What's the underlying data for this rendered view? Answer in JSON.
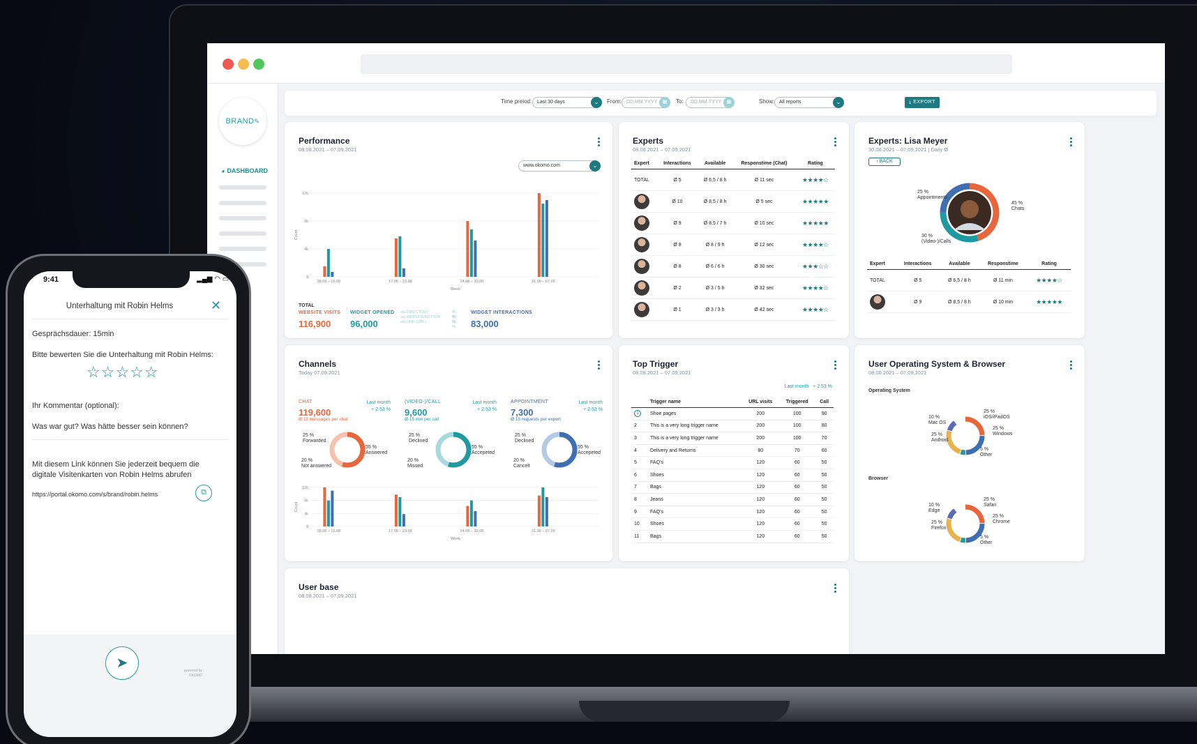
{
  "toolbar": {
    "time_label": "Time preiod:",
    "time_value": "Last 30 days",
    "from_label": "From:",
    "to_label": "To:",
    "date_placeholder": "DD.MM.YYYY",
    "show_label": "Show:",
    "show_value": "All reports",
    "export_label": "EXPORT"
  },
  "sidebar": {
    "brand": "BRAND",
    "nav_active": "DASHBOARD"
  },
  "performance": {
    "title": "Performance",
    "subtitle": "08.08.2021 – 07.09.2021",
    "filter": "www.okomo.com",
    "total_label": "TOTAL",
    "stats": [
      {
        "label": "WEBSITE VISITS",
        "value": "116,900"
      },
      {
        "label": "WIDGET OPENED",
        "value": "96,000"
      },
      {
        "label": "WIDGET INTERACTIONS",
        "value": "83,000"
      }
    ],
    "via": [
      {
        "label": "via DIRECTORY",
        "pct": "45 %"
      },
      {
        "label": "via WEBSITE/BUTTON",
        "pct": "40 %"
      },
      {
        "label": "via LINK (URL)",
        "pct": "15 %"
      }
    ]
  },
  "experts": {
    "title": "Experts",
    "subtitle": "08.08.2021 – 07.09.2021",
    "columns": [
      "Expert",
      "Interactions",
      "Available",
      "Responstime (Chat)",
      "Rating"
    ],
    "rows": [
      {
        "expert": "TOTAL",
        "inter": "Ø 5",
        "avail": "Ø 6,5 / 8 h",
        "resp": "Ø 11 sec",
        "rating": 4
      },
      {
        "expert": "",
        "inter": "Ø 10",
        "avail": "Ø 8,5 / 8 h",
        "resp": "Ø 5 sec",
        "rating": 5
      },
      {
        "expert": "",
        "inter": "Ø 9",
        "avail": "Ø 8,5 / 7 h",
        "resp": "Ø 10 sec",
        "rating": 5
      },
      {
        "expert": "",
        "inter": "Ø 8",
        "avail": "Ø 8 / 9 h",
        "resp": "Ø 12 sec",
        "rating": 4
      },
      {
        "expert": "",
        "inter": "Ø 8",
        "avail": "Ø 6 / 6 h",
        "resp": "Ø 30 sec",
        "rating": 3
      },
      {
        "expert": "",
        "inter": "Ø 2",
        "avail": "Ø 3 / 5 h",
        "resp": "Ø 32 sec",
        "rating": 4
      },
      {
        "expert": "",
        "inter": "Ø 1",
        "avail": "Ø 3 / 3 h",
        "resp": "Ø 42 sec",
        "rating": 4
      }
    ]
  },
  "lisa": {
    "title": "Experts: Lisa Meyer",
    "subtitle": "30.08.2021 – 07.09.2021 | Daily Ø",
    "back": "BACK",
    "donut_labels": [
      {
        "pct": "25 %",
        "name": "Appointments"
      },
      {
        "pct": "45 %",
        "name": "Chats"
      },
      {
        "pct": "30 %",
        "name": "(Video-)/Calls"
      }
    ],
    "columns": [
      "Expert",
      "Interactions",
      "Available",
      "Responstime",
      "Rating"
    ],
    "rows": [
      {
        "expert": "TOTAL",
        "inter": "Ø 5",
        "avail": "Ø 6,5 / 8 h",
        "resp": "Ø 11 min",
        "rating": 4
      },
      {
        "expert": "",
        "inter": "Ø 9",
        "avail": "Ø 8,5 / 8 h",
        "resp": "Ø 10 min",
        "rating": 5
      }
    ]
  },
  "channels": {
    "title": "Channels",
    "subtitle": "Today 07.09.2021",
    "blocks": [
      {
        "label": "CHAT",
        "value": "119,600",
        "sub": "Ø 15 messages per chat",
        "lm": "Last month",
        "delta": "+ 2.53 %",
        "a": "25 %",
        "an": "Forwarded",
        "b": "55 %",
        "bn": "Answered",
        "c": "20 %",
        "cn": "Not answered"
      },
      {
        "label": "(VIDEO-)/CALL",
        "value": "9,600",
        "sub": "Ø 15 min per call",
        "lm": "Last month",
        "delta": "+ 2.53 %",
        "a": "25 %",
        "an": "Declined",
        "b": "55 %",
        "bn": "Accepeted",
        "c": "20 %",
        "cn": "Missed"
      },
      {
        "label": "APPOINTMENT",
        "value": "7,300",
        "sub": "Ø 15 requests per expert",
        "lm": "Last month",
        "delta": "+ 2.53 %",
        "a": "25 %",
        "an": "Declined",
        "b": "55 %",
        "bn": "Accepeted",
        "c": "20 %",
        "cn": "Cancelt"
      }
    ]
  },
  "trigger": {
    "title": "Top Trigger",
    "subtitle": "08.08.2021 – 07.09.2021",
    "lm": "Last month",
    "delta": "+ 2.53 %",
    "columns": [
      "Trigger name",
      "URL visits",
      "Triggered",
      "Call"
    ],
    "rows": [
      {
        "n": "",
        "name": "Shoe pages",
        "url": "200",
        "trig": "100",
        "call": "90"
      },
      {
        "n": "2",
        "name": "This is a very long trigger name",
        "url": "200",
        "trig": "100",
        "call": "80"
      },
      {
        "n": "3",
        "name": "This is a very long trigger name",
        "url": "200",
        "trig": "100",
        "call": "70"
      },
      {
        "n": "4",
        "name": "Delivery and Returns",
        "url": "80",
        "trig": "70",
        "call": "60"
      },
      {
        "n": "5",
        "name": "FAQ's",
        "url": "120",
        "trig": "60",
        "call": "50"
      },
      {
        "n": "6",
        "name": "Shoes",
        "url": "120",
        "trig": "60",
        "call": "50"
      },
      {
        "n": "7",
        "name": "Bags",
        "url": "120",
        "trig": "60",
        "call": "50"
      },
      {
        "n": "8",
        "name": "Jeans",
        "url": "120",
        "trig": "60",
        "call": "50"
      },
      {
        "n": "9",
        "name": "FAQ's",
        "url": "120",
        "trig": "60",
        "call": "50"
      },
      {
        "n": "10",
        "name": "Shoes",
        "url": "120",
        "trig": "60",
        "call": "50"
      },
      {
        "n": "11",
        "name": "Bags",
        "url": "120",
        "trig": "60",
        "call": "50"
      }
    ]
  },
  "os": {
    "title": "User Operating System & Browser",
    "subtitle": "08.08.2021 – 07.09.2021",
    "os_label": "Operating System",
    "browser_label": "Browser",
    "os_items": [
      {
        "pct": "25 %",
        "name": "iOS/iPadOS"
      },
      {
        "pct": "25 %",
        "name": "Windows"
      },
      {
        "pct": "5 %",
        "name": "Other"
      },
      {
        "pct": "25 %",
        "name": "Android"
      },
      {
        "pct": "10 %",
        "name": "Mac OS"
      }
    ],
    "browser_items": [
      {
        "pct": "25 %",
        "name": "Safari"
      },
      {
        "pct": "25 %",
        "name": "Chrome"
      },
      {
        "pct": "5 %",
        "name": "Other"
      },
      {
        "pct": "25 %",
        "name": "Firefox"
      },
      {
        "pct": "10 %",
        "name": "Edge"
      }
    ]
  },
  "userbase": {
    "title": "User base",
    "subtitle": "08.08.2021 – 07.09.2021"
  },
  "phone": {
    "time": "9:41",
    "header": "Unterhaltung mit Robin Helms",
    "duration": "Gesprächsdauer: 15min",
    "rate_prompt": "Bitte bewerten Sie die Unterhaltung mit Robin Helms:",
    "comment_label": "Ihr Kommentar (optional):",
    "comment_placeholder": "Was war gut? Was hätte besser sein können?",
    "link_text": "Mit diesem Link können Sie jederzeit bequem die digitale Visitenkarten von Robin Helms abrufen",
    "url": "https://portal.okomo.com/s/brand/robin.helms",
    "powered": "powered by",
    "powered_brand": "OKOMO"
  },
  "colors": {
    "orange": "#e8663c",
    "teal": "#1f9aa0",
    "blue": "#3f6fb0",
    "dark_teal": "#1c7a80"
  },
  "chart_data": [
    {
      "type": "bar",
      "title": "Performance",
      "categories": [
        "08.08 – 16.08",
        "17.08 – 23.08",
        "24.08 – 30.08",
        "31.08 – 07.09"
      ],
      "xlabel": "Week",
      "ylabel": "Count",
      "ylim": [
        0,
        12000
      ],
      "yticks": [
        "0",
        "4k",
        "8k",
        "12k"
      ],
      "series": [
        {
          "name": "WEBSITE VISITS",
          "values": [
            1500,
            5500,
            8000,
            12000
          ]
        },
        {
          "name": "WIDGET OPENED",
          "values": [
            4000,
            5800,
            6800,
            10500
          ]
        },
        {
          "name": "WIDGET INTERACTIONS",
          "values": [
            700,
            1200,
            5200,
            11000
          ]
        }
      ]
    },
    {
      "type": "bar",
      "title": "Channels",
      "categories": [
        "08.08 – 16.08",
        "17.08 – 23.08",
        "24.08 – 30.08",
        "31.08 – 07.09"
      ],
      "xlabel": "Week",
      "ylabel": "Count",
      "ylim": [
        0,
        12000
      ],
      "yticks": [
        "0",
        "4k",
        "8k",
        "12k"
      ],
      "series": [
        {
          "name": "CHAT",
          "values": [
            12000,
            9800,
            6300,
            9500
          ]
        },
        {
          "name": "(VIDEO-)/CALL",
          "values": [
            8000,
            9000,
            8000,
            12000
          ]
        },
        {
          "name": "APPOINTMENT",
          "values": [
            11000,
            3800,
            4700,
            9000
          ]
        }
      ]
    }
  ]
}
